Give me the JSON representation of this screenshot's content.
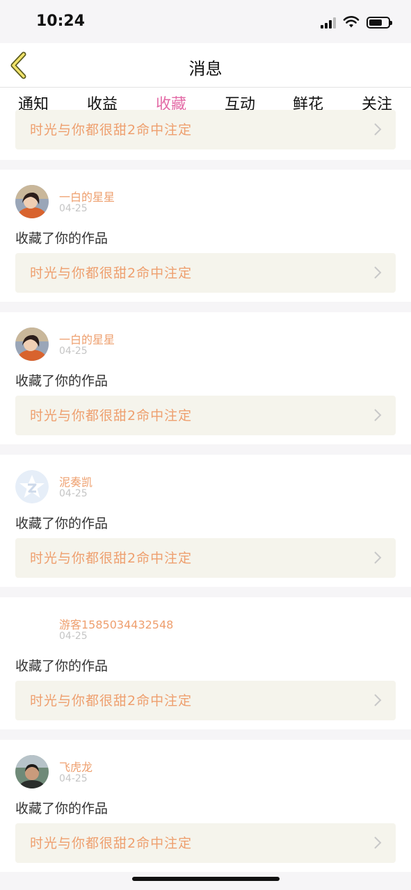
{
  "status_bar": {
    "time": "10:24"
  },
  "nav": {
    "title": "消息"
  },
  "tabs": [
    {
      "label": "通知"
    },
    {
      "label": "收益"
    },
    {
      "label": "收藏",
      "active": true
    },
    {
      "label": "互动"
    },
    {
      "label": "鲜花"
    },
    {
      "label": "关注"
    }
  ],
  "top_fragment": {
    "work_title": "时光与你都很甜2命中注定"
  },
  "cards": [
    {
      "username": "一白的星星",
      "date": "04-25",
      "action": "收藏了你的作品",
      "work_title": "时光与你都很甜2命中注定",
      "avatar": "portrait-avatar-1"
    },
    {
      "username": "一白的星星",
      "date": "04-25",
      "action": "收藏了你的作品",
      "work_title": "时光与你都很甜2命中注定",
      "avatar": "portrait-avatar-1"
    },
    {
      "username": "泥奏凯",
      "date": "04-25",
      "action": "收藏了你的作品",
      "work_title": "时光与你都很甜2命中注定",
      "avatar": "qzone-star-avatar"
    },
    {
      "username": "游客1585034432548",
      "date": "04-25",
      "action": "收藏了你的作品",
      "work_title": "时光与你都很甜2命中注定",
      "avatar": "none"
    },
    {
      "username": "飞虎龙",
      "date": "04-25",
      "action": "收藏了你的作品",
      "work_title": "时光与你都很甜2命中注定",
      "avatar": "portrait-avatar-2"
    }
  ],
  "colors": {
    "accent_pink": "#e36aa6",
    "username_orange": "#ee9f6e",
    "link_bg": "#f5f4ec",
    "page_bg": "#f6f5f7"
  }
}
